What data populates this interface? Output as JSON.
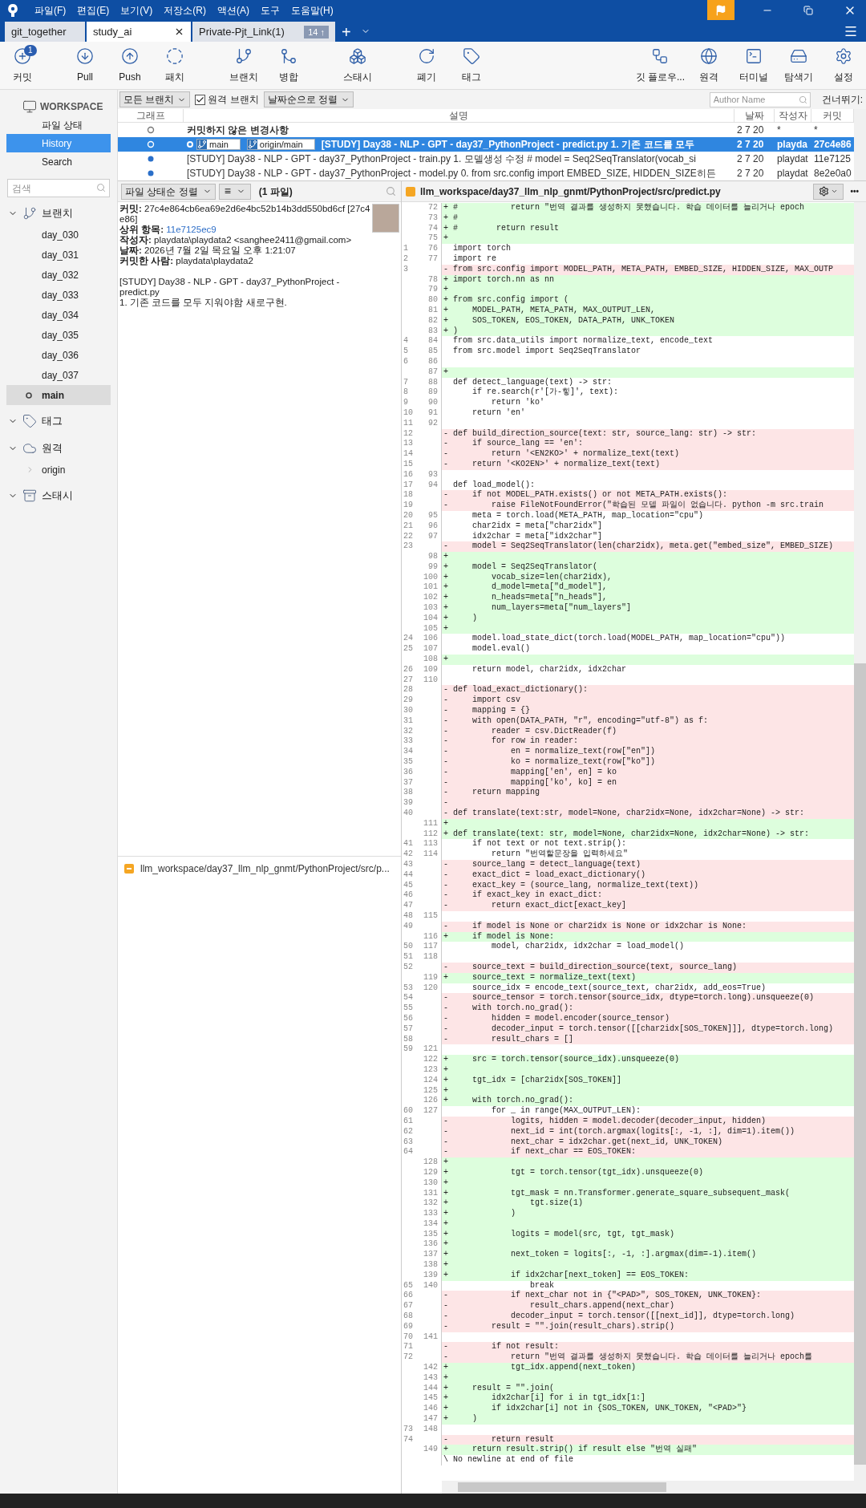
{
  "menu": [
    "파일(F)",
    "편집(E)",
    "보기(V)",
    "저장소(R)",
    "액션(A)",
    "도구",
    "도움말(H)"
  ],
  "tabs": [
    {
      "label": "git_together",
      "selected": false
    },
    {
      "label": "study_ai",
      "selected": true
    },
    {
      "label": "Private-Pjt_Link(1)",
      "selected": false,
      "badge": "14 ↑"
    }
  ],
  "new_tab": "+",
  "toolbar": {
    "left": [
      {
        "label": "커밋",
        "badge": "1"
      },
      {
        "label": "Pull"
      },
      {
        "label": "Push"
      },
      {
        "label": "패치"
      },
      {
        "label": "브랜치"
      },
      {
        "label": "병합"
      },
      {
        "label": "스태시"
      },
      {
        "label": "폐기"
      },
      {
        "label": "태그"
      }
    ],
    "right": [
      {
        "label": "깃 플로우..."
      },
      {
        "label": "원격"
      },
      {
        "label": "터미널"
      },
      {
        "label": "탐색기"
      },
      {
        "label": "설정"
      }
    ]
  },
  "sidebar": {
    "workspace": "WORKSPACE",
    "nav": [
      {
        "label": "파일 상태",
        "selected": false
      },
      {
        "label": "History",
        "selected": true
      },
      {
        "label": "Search",
        "selected": false
      }
    ],
    "search_placeholder": "검색",
    "sections": [
      {
        "label": "브랜치",
        "expanded": true,
        "items": [
          {
            "label": "day_030",
            "selected": false,
            "current": false
          },
          {
            "label": "day_031",
            "selected": false,
            "current": false
          },
          {
            "label": "day_032",
            "selected": false,
            "current": false
          },
          {
            "label": "day_033",
            "selected": false,
            "current": false
          },
          {
            "label": "day_034",
            "selected": false,
            "current": false
          },
          {
            "label": "day_035",
            "selected": false,
            "current": false
          },
          {
            "label": "day_036",
            "selected": false,
            "current": false
          },
          {
            "label": "day_037",
            "selected": false,
            "current": false
          },
          {
            "label": "main",
            "selected": true,
            "current": true
          }
        ]
      },
      {
        "label": "태그",
        "expanded": true
      },
      {
        "label": "원격",
        "expanded": true,
        "items": [
          {
            "label": "origin",
            "selected": false,
            "current": false,
            "expandable": true
          }
        ]
      },
      {
        "label": "스태시",
        "expanded": true
      }
    ]
  },
  "filters": {
    "branches": "모든 브랜치",
    "remote_branches": {
      "label": "원격 브랜치",
      "checked": true
    },
    "sort": "날짜순으로 정렬",
    "author_placeholder": "Author Name",
    "skip_label": "건너뛰기:"
  },
  "commits": {
    "columns": [
      "그래프",
      "설명",
      "날짜",
      "작성자",
      "커밋"
    ],
    "rows": [
      {
        "kind": "uncommitted",
        "selected": false,
        "description": "커밋하지 않은 변경사항",
        "date": "2 7 20",
        "author": "*",
        "commit": "*",
        "refs": []
      },
      {
        "kind": "commit",
        "selected": true,
        "head": true,
        "description": "[STUDY] Day38 - NLP - GPT - day37_PythonProject - predict.py 1. 기존 코드를 모두",
        "date": "2 7 20",
        "author": "playda",
        "commit": "27c4e86",
        "refs": [
          "main",
          "origin/main"
        ]
      },
      {
        "kind": "commit",
        "selected": false,
        "head": false,
        "description": "[STUDY] Day38 - NLP - GPT - day37_PythonProject - train.py 1.   모델생성 수정     # model = Seq2SeqTranslator(vocab_si",
        "date": "2 7 20",
        "author": "playdat",
        "commit": "11e7125",
        "refs": []
      },
      {
        "kind": "commit",
        "selected": false,
        "head": false,
        "description": "[STUDY] Day38 - NLP - GPT - day37_PythonProject - model.py 0. from src.config import EMBED_SIZE, HIDDEN_SIZE히든",
        "date": "2 7 20",
        "author": "playdat",
        "commit": "8e2e0a0",
        "refs": []
      }
    ]
  },
  "files_toolbar": {
    "sort": "파일 상태순 정렬",
    "view": "≡",
    "count": "(1 파일)"
  },
  "details": {
    "fields": [
      {
        "label": "커밋:",
        "value": "27c4e864cb6ea69e2d6e4bc52b14b3dd550bd6cf [27c4e86]",
        "kind": "text"
      },
      {
        "label": "상위 항목:",
        "value": "11e7125ec9",
        "kind": "link"
      },
      {
        "label": "작성자:",
        "value": "playdata\\playdata2 <sanghee2411@gmail.com>",
        "kind": "text"
      },
      {
        "label": "날짜:",
        "value": "2026년 7월 2일 목요일 오후 1:21:07",
        "kind": "text"
      },
      {
        "label": "커밋한 사람:",
        "value": "playdata\\playdata2",
        "kind": "text"
      }
    ],
    "message": [
      "[STUDY] Day38 - NLP - GPT - day37_PythonProject - predict.py",
      "1. 기존 코드를 모두 지워야함 새로구현."
    ]
  },
  "files": [
    {
      "path": "llm_workspace/day37_llm_nlp_gnmt/PythonProject/src/p..."
    }
  ],
  "diff": {
    "path": "llm_workspace/day37_llm_nlp_gnmt/PythonProject/src/predict.py",
    "more": "•••",
    "lines": [
      {
        "new": "72",
        "kind": "add",
        "text": "+ #           return \"번역 결과를 생성하지 못했습니다. 학습 데이터를 늘리거나 epoch"
      },
      {
        "new": "73",
        "kind": "add",
        "text": "+ #"
      },
      {
        "new": "74",
        "kind": "add",
        "text": "+ #        return result"
      },
      {
        "new": "75",
        "kind": "add",
        "text": "+"
      },
      {
        "old": "1",
        "new": "76",
        "kind": "ctx",
        "text": "  import torch"
      },
      {
        "old": "2",
        "new": "77",
        "kind": "ctx",
        "text": "  import re"
      },
      {
        "old": "3",
        "kind": "del",
        "text": "- from src.config import MODEL_PATH, META_PATH, EMBED_SIZE, HIDDEN_SIZE, MAX_OUTP"
      },
      {
        "new": "78",
        "kind": "add",
        "text": "+ import torch.nn as nn"
      },
      {
        "new": "79",
        "kind": "add",
        "text": "+"
      },
      {
        "new": "80",
        "kind": "add",
        "text": "+ from src.config import ("
      },
      {
        "new": "81",
        "kind": "add",
        "text": "+     MODEL_PATH, META_PATH, MAX_OUTPUT_LEN,"
      },
      {
        "new": "82",
        "kind": "add",
        "text": "+     SOS_TOKEN, EOS_TOKEN, DATA_PATH, UNK_TOKEN"
      },
      {
        "new": "83",
        "kind": "add",
        "text": "+ )"
      },
      {
        "old": "4",
        "new": "84",
        "kind": "ctx",
        "text": "  from src.data_utils import normalize_text, encode_text"
      },
      {
        "old": "5",
        "new": "85",
        "kind": "ctx",
        "text": "  from src.model import Seq2SeqTranslator"
      },
      {
        "old": "6",
        "new": "86",
        "kind": "ctx"
      },
      {
        "new": "87",
        "kind": "add",
        "text": "+"
      },
      {
        "old": "7",
        "new": "88",
        "kind": "ctx",
        "text": "  def detect_language(text) -> str:"
      },
      {
        "old": "8",
        "new": "89",
        "kind": "ctx",
        "text": "      if re.search(r'[가-힣]', text):"
      },
      {
        "old": "9",
        "new": "90",
        "kind": "ctx",
        "text": "          return 'ko'"
      },
      {
        "old": "10",
        "new": "91",
        "kind": "ctx",
        "text": "      return 'en'"
      },
      {
        "old": "11",
        "new": "92",
        "kind": "ctx"
      },
      {
        "old": "12",
        "kind": "del",
        "text": "- def build_direction_source(text: str, source_lang: str) -> str:"
      },
      {
        "old": "13",
        "kind": "del",
        "text": "-     if source_lang == 'en':"
      },
      {
        "old": "14",
        "kind": "del",
        "text": "-         return '<EN2KO>' + normalize_text(text)"
      },
      {
        "old": "15",
        "kind": "del",
        "text": "-     return '<KO2EN>' + normalize_text(text)"
      },
      {
        "old": "16",
        "new": "93",
        "kind": "ctx"
      },
      {
        "old": "17",
        "new": "94",
        "kind": "ctx",
        "text": "  def load_model():"
      },
      {
        "old": "18",
        "kind": "del",
        "text": "-     if not MODEL_PATH.exists() or not META_PATH.exists():"
      },
      {
        "old": "19",
        "kind": "del",
        "text": "-         raise FileNotFoundError(\"학습된 모델 파일이 없습니다. python -m src.train"
      },
      {
        "old": "20",
        "new": "95",
        "kind": "ctx",
        "text": "      meta = torch.load(META_PATH, map_location=\"cpu\")"
      },
      {
        "old": "21",
        "new": "96",
        "kind": "ctx",
        "text": "      char2idx = meta[\"char2idx\"]"
      },
      {
        "old": "22",
        "new": "97",
        "kind": "ctx",
        "text": "      idx2char = meta[\"idx2char\"]"
      },
      {
        "old": "23",
        "kind": "del",
        "text": "-     model = Seq2SeqTranslator(len(char2idx), meta.get(\"embed_size\", EMBED_SIZE)"
      },
      {
        "new": "98",
        "kind": "add",
        "text": "+"
      },
      {
        "new": "99",
        "kind": "add",
        "text": "+     model = Seq2SeqTranslator("
      },
      {
        "new": "100",
        "kind": "add",
        "text": "+         vocab_size=len(char2idx),"
      },
      {
        "new": "101",
        "kind": "add",
        "text": "+         d_model=meta[\"d_model\"],"
      },
      {
        "new": "102",
        "kind": "add",
        "text": "+         n_heads=meta[\"n_heads\"],"
      },
      {
        "new": "103",
        "kind": "add",
        "text": "+         num_layers=meta[\"num_layers\"]"
      },
      {
        "new": "104",
        "kind": "add",
        "text": "+     )"
      },
      {
        "new": "105",
        "kind": "add",
        "text": "+"
      },
      {
        "old": "24",
        "new": "106",
        "kind": "ctx",
        "text": "      model.load_state_dict(torch.load(MODEL_PATH, map_location=\"cpu\"))"
      },
      {
        "old": "25",
        "new": "107",
        "kind": "ctx",
        "text": "      model.eval()"
      },
      {
        "new": "108",
        "kind": "add",
        "text": "+"
      },
      {
        "old": "26",
        "new": "109",
        "kind": "ctx",
        "text": "      return model, char2idx, idx2char"
      },
      {
        "old": "27",
        "new": "110",
        "kind": "ctx"
      },
      {
        "old": "28",
        "kind": "del",
        "text": "- def load_exact_dictionary():"
      },
      {
        "old": "29",
        "kind": "del",
        "text": "-     import csv"
      },
      {
        "old": "30",
        "kind": "del",
        "text": "-     mapping = {}"
      },
      {
        "old": "31",
        "kind": "del",
        "text": "-     with open(DATA_PATH, \"r\", encoding=\"utf-8\") as f:"
      },
      {
        "old": "32",
        "kind": "del",
        "text": "-         reader = csv.DictReader(f)"
      },
      {
        "old": "33",
        "kind": "del",
        "text": "-         for row in reader:"
      },
      {
        "old": "34",
        "kind": "del",
        "text": "-             en = normalize_text(row[\"en\"])"
      },
      {
        "old": "35",
        "kind": "del",
        "text": "-             ko = normalize_text(row[\"ko\"])"
      },
      {
        "old": "36",
        "kind": "del",
        "text": "-             mapping['en', en] = ko"
      },
      {
        "old": "37",
        "kind": "del",
        "text": "-             mapping['ko', ko] = en"
      },
      {
        "old": "38",
        "kind": "del",
        "text": "-     return mapping"
      },
      {
        "old": "39",
        "kind": "del",
        "text": "-"
      },
      {
        "old": "40",
        "kind": "del",
        "text": "- def translate(text:str, model=None, char2idx=None, idx2char=None) -> str:"
      },
      {
        "new": "111",
        "kind": "add",
        "text": "+"
      },
      {
        "new": "112",
        "kind": "add",
        "text": "+ def translate(text: str, model=None, char2idx=None, idx2char=None) -> str:"
      },
      {
        "old": "41",
        "new": "113",
        "kind": "ctx",
        "text": "      if not text or not text.strip():"
      },
      {
        "old": "42",
        "new": "114",
        "kind": "ctx",
        "text": "          return \"번역할문장을 입력하세요\""
      },
      {
        "old": "43",
        "kind": "del",
        "text": "-     source_lang = detect_language(text)"
      },
      {
        "old": "44",
        "kind": "del",
        "text": "-     exact_dict = load_exact_dictionary()"
      },
      {
        "old": "45",
        "kind": "del",
        "text": "-     exact_key = (source_lang, normalize_text(text))"
      },
      {
        "old": "46",
        "kind": "del",
        "text": "-     if exact_key in exact_dict:"
      },
      {
        "old": "47",
        "kind": "del",
        "text": "-         return exact_dict[exact_key]"
      },
      {
        "old": "48",
        "new": "115",
        "kind": "ctx"
      },
      {
        "old": "49",
        "kind": "del",
        "text": "-     if model is None or char2idx is None or idx2char is None:"
      },
      {
        "new": "116",
        "kind": "add",
        "text": "+     if model is None:"
      },
      {
        "old": "50",
        "new": "117",
        "kind": "ctx",
        "text": "          model, char2idx, idx2char = load_model()"
      },
      {
        "old": "51",
        "new": "118",
        "kind": "ctx"
      },
      {
        "old": "52",
        "kind": "del",
        "text": "-     source_text = build_direction_source(text, source_lang)"
      },
      {
        "new": "119",
        "kind": "add",
        "text": "+     source_text = normalize_text(text)"
      },
      {
        "old": "53",
        "new": "120",
        "kind": "ctx",
        "text": "      source_idx = encode_text(source_text, char2idx, add_eos=True)"
      },
      {
        "old": "54",
        "kind": "del",
        "text": "-     source_tensor = torch.tensor(source_idx, dtype=torch.long).unsqueeze(0)"
      },
      {
        "old": "55",
        "kind": "del",
        "text": "-     with torch.no_grad():"
      },
      {
        "old": "56",
        "kind": "del",
        "text": "-         hidden = model.encoder(source_tensor)"
      },
      {
        "old": "57",
        "kind": "del",
        "text": "-         decoder_input = torch.tensor([[char2idx[SOS_TOKEN]]], dtype=torch.long)"
      },
      {
        "old": "58",
        "kind": "del",
        "text": "-         result_chars = []"
      },
      {
        "old": "59",
        "new": "121",
        "kind": "ctx"
      },
      {
        "new": "122",
        "kind": "add",
        "text": "+     src = torch.tensor(source_idx).unsqueeze(0)"
      },
      {
        "new": "123",
        "kind": "add",
        "text": "+"
      },
      {
        "new": "124",
        "kind": "add",
        "text": "+     tgt_idx = [char2idx[SOS_TOKEN]]"
      },
      {
        "new": "125",
        "kind": "add",
        "text": "+"
      },
      {
        "new": "126",
        "kind": "add",
        "text": "+     with torch.no_grad():"
      },
      {
        "old": "60",
        "new": "127",
        "kind": "ctx",
        "text": "          for _ in range(MAX_OUTPUT_LEN):"
      },
      {
        "old": "61",
        "kind": "del",
        "text": "-             logits, hidden = model.decoder(decoder_input, hidden)"
      },
      {
        "old": "62",
        "kind": "del",
        "text": "-             next_id = int(torch.argmax(logits[:, -1, :], dim=1).item())"
      },
      {
        "old": "63",
        "kind": "del",
        "text": "-             next_char = idx2char.get(next_id, UNK_TOKEN)"
      },
      {
        "old": "64",
        "kind": "del",
        "text": "-             if next_char == EOS_TOKEN:"
      },
      {
        "new": "128",
        "kind": "add",
        "text": "+"
      },
      {
        "new": "129",
        "kind": "add",
        "text": "+             tgt = torch.tensor(tgt_idx).unsqueeze(0)"
      },
      {
        "new": "130",
        "kind": "add",
        "text": "+"
      },
      {
        "new": "131",
        "kind": "add",
        "text": "+             tgt_mask = nn.Transformer.generate_square_subsequent_mask("
      },
      {
        "new": "132",
        "kind": "add",
        "text": "+                 tgt.size(1)"
      },
      {
        "new": "133",
        "kind": "add",
        "text": "+             )"
      },
      {
        "new": "134",
        "kind": "add",
        "text": "+"
      },
      {
        "new": "135",
        "kind": "add",
        "text": "+             logits = model(src, tgt, tgt_mask)"
      },
      {
        "new": "136",
        "kind": "add",
        "text": "+"
      },
      {
        "new": "137",
        "kind": "add",
        "text": "+             next_token = logits[:, -1, :].argmax(dim=-1).item()"
      },
      {
        "new": "138",
        "kind": "add",
        "text": "+"
      },
      {
        "new": "139",
        "kind": "add",
        "text": "+             if idx2char[next_token] == EOS_TOKEN:"
      },
      {
        "old": "65",
        "new": "140",
        "kind": "ctx",
        "text": "                  break"
      },
      {
        "old": "66",
        "kind": "del",
        "text": "-             if next_char not in {\"<PAD>\", SOS_TOKEN, UNK_TOKEN}:"
      },
      {
        "old": "67",
        "kind": "del",
        "text": "-                 result_chars.append(next_char)"
      },
      {
        "old": "68",
        "kind": "del",
        "text": "-             decoder_input = torch.tensor([[next_id]], dtype=torch.long)"
      },
      {
        "old": "69",
        "kind": "del",
        "text": "-         result = \"\".join(result_chars).strip()"
      },
      {
        "old": "70",
        "new": "141",
        "kind": "ctx"
      },
      {
        "old": "71",
        "kind": "del",
        "text": "-         if not result:"
      },
      {
        "old": "72",
        "kind": "del",
        "text": "-             return \"번역 결과를 생성하지 못했습니다. 학습 데이터를 늘리거나 epoch를"
      },
      {
        "new": "142",
        "kind": "add",
        "text": "+             tgt_idx.append(next_token)"
      },
      {
        "new": "143",
        "kind": "add",
        "text": "+"
      },
      {
        "new": "144",
        "kind": "add",
        "text": "+     result = \"\".join("
      },
      {
        "new": "145",
        "kind": "add",
        "text": "+         idx2char[i] for i in tgt_idx[1:]"
      },
      {
        "new": "146",
        "kind": "add",
        "text": "+         if idx2char[i] not in {SOS_TOKEN, UNK_TOKEN, \"<PAD>\"}"
      },
      {
        "new": "147",
        "kind": "add",
        "text": "+     )"
      },
      {
        "old": "73",
        "new": "148",
        "kind": "ctx"
      },
      {
        "old": "74",
        "kind": "del",
        "text": "-         return result"
      },
      {
        "new": "149",
        "kind": "add",
        "text": "+     return result.strip() if result else \"번역 실패\""
      },
      {
        "kind": "note",
        "text": "\\ No newline at end of file"
      }
    ]
  }
}
